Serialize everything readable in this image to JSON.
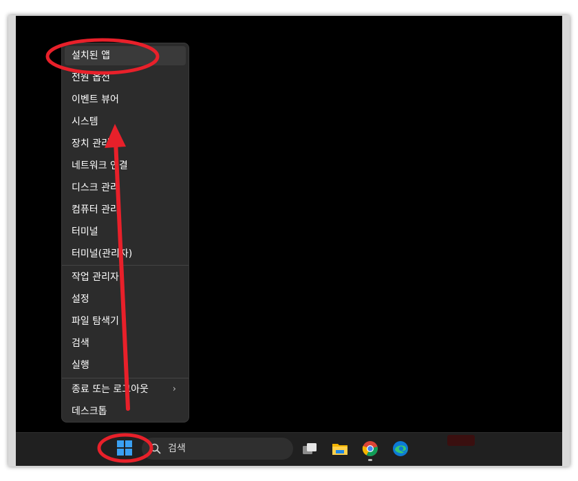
{
  "context_menu": {
    "items": [
      {
        "label": "설치된 앱",
        "highlighted": true
      },
      {
        "label": "전원 옵션"
      },
      {
        "label": "이벤트 뷰어"
      },
      {
        "label": "시스템"
      },
      {
        "label": "장치 관리자"
      },
      {
        "label": "네트워크 연결"
      },
      {
        "label": "디스크 관리"
      },
      {
        "label": "컴퓨터 관리"
      },
      {
        "label": "터미널"
      },
      {
        "label": "터미널(관리자)"
      },
      {
        "label": "작업 관리자"
      },
      {
        "label": "설정"
      },
      {
        "label": "파일 탐색기"
      },
      {
        "label": "검색"
      },
      {
        "label": "실행"
      },
      {
        "label": "종료 또는 로그아웃",
        "submenu_chevron": "›"
      },
      {
        "label": "데스크톱"
      }
    ]
  },
  "taskbar": {
    "search_label": "검색",
    "icons": [
      "start-icon",
      "search-icon",
      "task-view-icon",
      "file-explorer-icon",
      "chrome-icon",
      "edge-icon"
    ]
  },
  "annotations": {
    "color": "#e8202a",
    "shapes": [
      "ellipse-around-installed-apps",
      "ellipse-around-start-button",
      "arrow-up-from-start-to-menu"
    ]
  }
}
